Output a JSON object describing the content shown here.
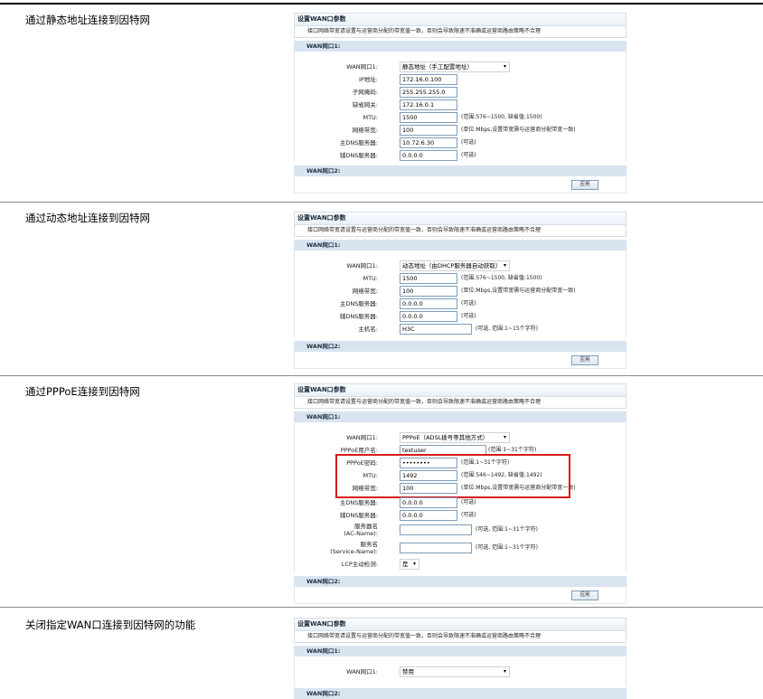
{
  "rows": [
    {
      "title": "通过静态地址连接到因特网"
    },
    {
      "title": "通过动态地址连接到因特网"
    },
    {
      "title": "通过PPPoE连接到因特网"
    },
    {
      "title": "关闭指定WAN口连接到因特网的功能"
    }
  ],
  "panel": {
    "title": "设置WAN口参数",
    "desc": "接口网络带宽请设置与运营商分配的带宽值一致，否则会导致限速不准确或运营商路由策略不合理",
    "wan1": "WAN网口1:",
    "wan2": "WAN网口2:",
    "apply": "应用"
  },
  "static": {
    "wan1_label": "WAN网口1:",
    "wan1_value": "静态地址（手工配置地址）",
    "ip_label": "IP地址:",
    "ip_value": "172.16.0.100",
    "mask_label": "子网掩码:",
    "mask_value": "255.255.255.0",
    "gw_label": "缺省网关:",
    "gw_value": "172.16.0.1",
    "mtu_label": "MTU:",
    "mtu_value": "1500",
    "mtu_hint": "(范围:576~1500, 缺省值:1500)",
    "bw_label": "网络带宽:",
    "bw_value": "100",
    "bw_hint": "(单位:Mbps,设置带宽需与运营商分配带宽一致)",
    "dns1_label": "主DNS服务器:",
    "dns1_value": "10.72.6.30",
    "dns1_hint": "(可选)",
    "dns2_label": "辅DNS服务器:",
    "dns2_value": "0.0.0.0",
    "dns2_hint": "(可选)"
  },
  "dynamic": {
    "wan1_label": "WAN网口1:",
    "wan1_value": "动态地址（由DHCP服务器自动获取）",
    "mtu_label": "MTU:",
    "mtu_value": "1500",
    "mtu_hint": "(范围:576~1500, 缺省值:1500)",
    "bw_label": "网络带宽:",
    "bw_value": "100",
    "bw_hint": "(单位:Mbps,设置带宽需与运营商分配带宽一致)",
    "dns1_label": "主DNS服务器:",
    "dns1_value": "0.0.0.0",
    "dns1_hint": "(可选)",
    "dns2_label": "辅DNS服务器:",
    "dns2_value": "0.0.0.0",
    "dns2_hint": "(可选)",
    "host_label": "主机名:",
    "host_value": "H3C",
    "host_hint": "(可选, 范围:1~15个字符)"
  },
  "pppoe": {
    "wan1_label": "WAN网口1:",
    "wan1_value": "PPPoE（ADSL拨号等其他方式）",
    "user_label": "PPPoE用户名:",
    "user_value": "testuser",
    "user_hint": "(范围:1~31个字符)",
    "pwd_label": "PPPoE密码:",
    "pwd_value": "••••••••",
    "pwd_hint": "(范围:1~31个字符)",
    "mtu_label": "MTU:",
    "mtu_value": "1492",
    "mtu_hint": "(范围:546~1492, 缺省值:1492)",
    "bw_label": "网络带宽:",
    "bw_value": "100",
    "bw_hint": "(单位:Mbps,设置带宽需与运营商分配带宽一致)",
    "dns1_label": "主DNS服务器:",
    "dns1_value": "0.0.0.0",
    "dns1_hint": "(可选)",
    "dns2_label": "辅DNS服务器:",
    "dns2_value": "0.0.0.0",
    "dns2_hint": "(可选)",
    "ac_label1": "服务器名",
    "ac_label2": "(AC-Name):",
    "ac_value": "",
    "ac_hint": "(可选, 范围:1~31个字符)",
    "svc_label1": "服务名",
    "svc_label2": "(Service-Name):",
    "svc_value": "",
    "svc_hint": "(可选, 范围:1~31个字符)",
    "lcp_label": "LCP主动检测:",
    "lcp_value": "是"
  },
  "off": {
    "wan1_label": "WAN网口1:",
    "wan1_value": "禁用"
  }
}
